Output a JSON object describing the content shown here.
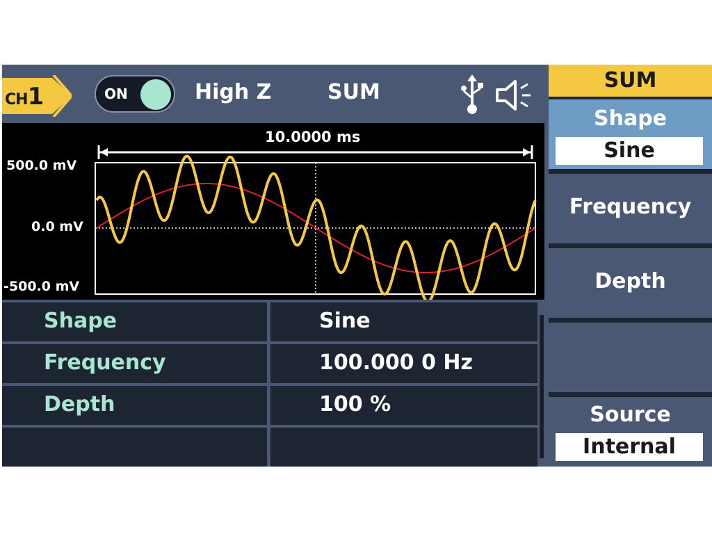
{
  "topbar": {
    "channel_prefix": "CH",
    "channel_number": "1",
    "output_state": "ON",
    "load": "High Z",
    "mode": "SUM"
  },
  "waveform": {
    "time_span": "10.0000 ms",
    "y_top": "500.0 mV",
    "y_mid": "0.0 mV",
    "y_bottom": "-500.0 mV",
    "carrier_color": "#f5c842",
    "modulating_color": "#e0202a"
  },
  "params": [
    {
      "name": "Shape",
      "value": "Sine"
    },
    {
      "name": "Frequency",
      "value": "100.000 0 Hz"
    },
    {
      "name": "Depth",
      "value": "100 %"
    },
    {
      "name": "",
      "value": ""
    }
  ],
  "menu": {
    "title": "SUM",
    "shape_label": "Shape",
    "shape_value": "Sine",
    "frequency_label": "Frequency",
    "depth_label": "Depth",
    "source_label": "Source",
    "source_value": "Internal"
  },
  "colors": {
    "accent_yellow": "#f5c842",
    "accent_green": "#a8e6cf",
    "panel_blue": "#4a5874",
    "active_blue": "#6f9cc4"
  }
}
